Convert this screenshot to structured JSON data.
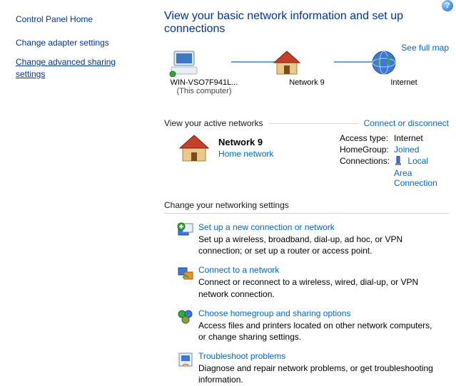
{
  "sidebar": {
    "home": "Control Panel Home",
    "links": [
      "Change adapter settings",
      "Change advanced sharing settings"
    ]
  },
  "header": {
    "title": "View your basic network information and set up connections",
    "see_full_map": "See full map"
  },
  "map": {
    "computer": {
      "name": "WIN-VSO7F941L...",
      "sub": "(This computer)"
    },
    "network": {
      "name": "Network  9"
    },
    "internet": {
      "name": "Internet"
    }
  },
  "active": {
    "header": "View your active networks",
    "connect_link": "Connect or disconnect",
    "name": "Network  9",
    "type_link": "Home network",
    "rows": {
      "access_label": "Access type:",
      "access_value": "Internet",
      "homegroup_label": "HomeGroup:",
      "homegroup_value": "Joined",
      "conn_label": "Connections:",
      "conn_value": "Local Area Connection"
    }
  },
  "settings": {
    "header": "Change your networking settings",
    "tasks": [
      {
        "title": "Set up a new connection or network",
        "desc": "Set up a wireless, broadband, dial-up, ad hoc, or VPN connection; or set up a router or access point."
      },
      {
        "title": "Connect to a network",
        "desc": "Connect or reconnect to a wireless, wired, dial-up, or VPN network connection."
      },
      {
        "title": "Choose homegroup and sharing options",
        "desc": "Access files and printers located on other network computers, or change sharing settings."
      },
      {
        "title": "Troubleshoot problems",
        "desc": "Diagnose and repair network problems, or get troubleshooting information."
      }
    ]
  }
}
